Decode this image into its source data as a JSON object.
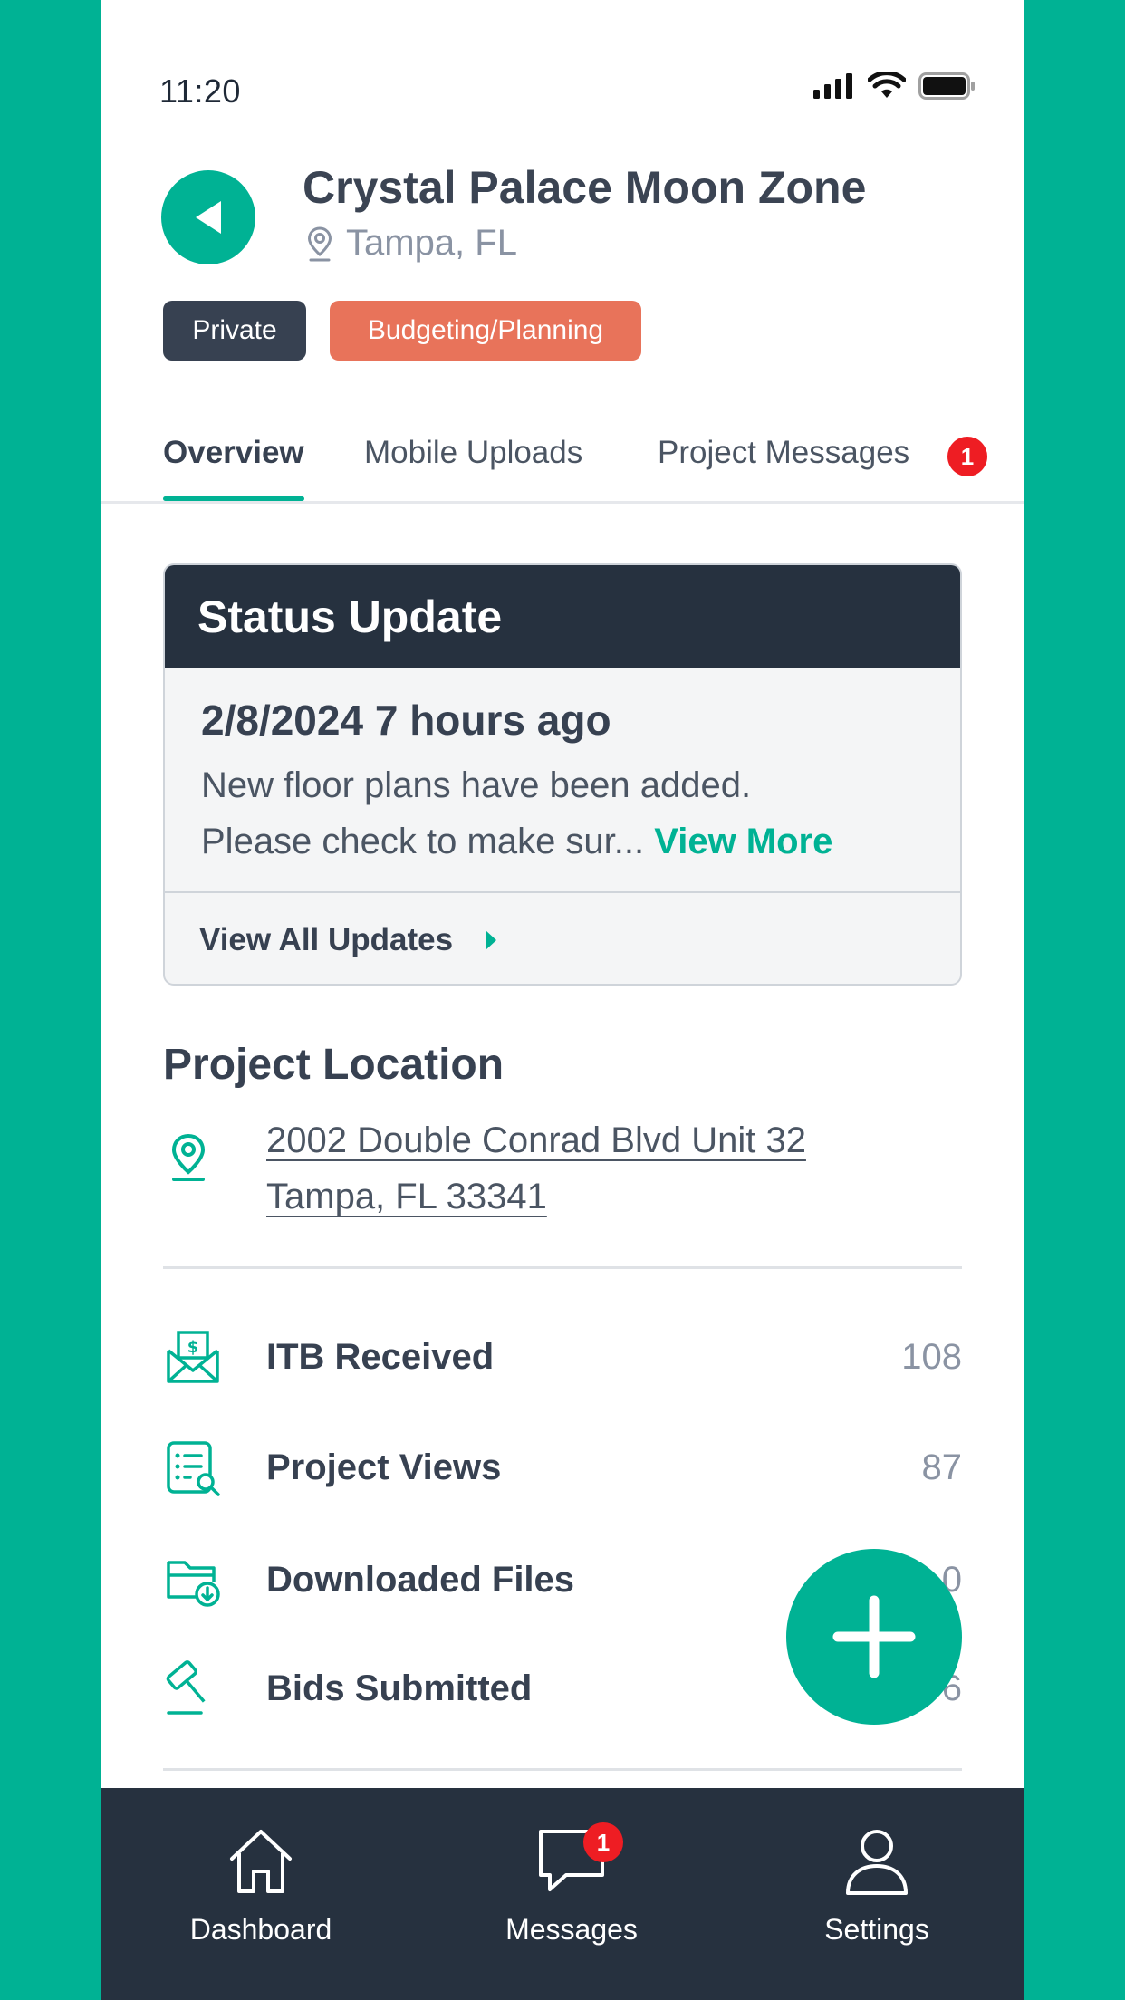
{
  "status_bar": {
    "time": "11:20"
  },
  "header": {
    "title": "Crystal Palace Moon Zone",
    "location": "Tampa, FL",
    "tags": {
      "privacy": "Private",
      "phase": "Budgeting/Planning"
    }
  },
  "tabs": {
    "overview": "Overview",
    "mobile_uploads": "Mobile Uploads",
    "project_messages": "Project Messages",
    "messages_badge": "1"
  },
  "status_update": {
    "heading": "Status Update",
    "date": "2/8/2024 7 hours ago",
    "line1": "New floor plans have been added.",
    "line2": "Please check to make sur...",
    "view_more": "View More",
    "view_all": "View All Updates"
  },
  "project_location": {
    "heading": "Project Location",
    "address_line1": "2002 Double Conrad Blvd Unit 32",
    "address_line2": "Tampa, FL 33341"
  },
  "stats": [
    {
      "label": "ITB Received",
      "value": "108",
      "icon": "envelope-dollar-icon"
    },
    {
      "label": "Project Views",
      "value": "87",
      "icon": "list-search-icon"
    },
    {
      "label": "Downloaded Files",
      "value": "0",
      "icon": "folder-download-icon"
    },
    {
      "label": "Bids Submitted",
      "value": "6",
      "icon": "gavel-icon"
    }
  ],
  "bottom_nav": {
    "dashboard": "Dashboard",
    "messages": "Messages",
    "settings": "Settings",
    "messages_badge": "1"
  },
  "colors": {
    "accent": "#00B294",
    "dark": "#26313f",
    "badge": "#ee1d23",
    "phase_tag": "#E8735A"
  }
}
